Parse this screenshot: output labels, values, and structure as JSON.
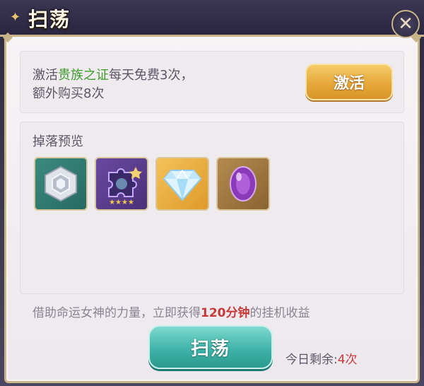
{
  "title": "扫荡",
  "close_icon": "close-icon",
  "vip": {
    "prefix": "激活",
    "highlight": "贵族之证",
    "suffix": "每天免费3次，",
    "line2": "额外购买8次",
    "highlight_color": "#3f9a2e",
    "button_label": "激活"
  },
  "drops": {
    "title": "掉落预览",
    "items": [
      {
        "icon": "silver-hexagon-icon"
      },
      {
        "icon": "purple-puzzle-piece-icon",
        "stars": "★★★★"
      },
      {
        "icon": "diamond-icon"
      },
      {
        "icon": "purple-gem-icon"
      }
    ]
  },
  "description": {
    "prefix": "借助命运女神的力量，立即获得",
    "highlight": "120分钟",
    "suffix": "的挂机收益",
    "highlight_color": "#c83a3a"
  },
  "sweep_button_label": "扫荡",
  "remaining": {
    "label": "今日剩余:",
    "count": "4次"
  }
}
